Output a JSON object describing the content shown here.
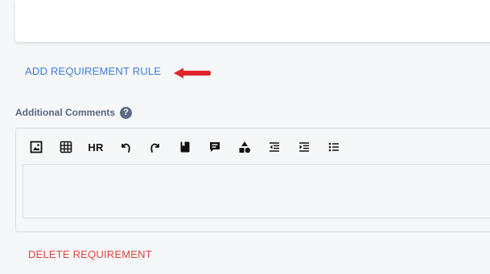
{
  "rule_section": {
    "add_rule_label": "ADD REQUIREMENT RULE",
    "link_color": "#3b7fd6",
    "annotation_arrow_color": "#e0262c"
  },
  "comments": {
    "label": "Additional Comments",
    "help_glyph": "?",
    "toolbar": {
      "buttons": [
        {
          "name": "image-icon"
        },
        {
          "name": "table-icon"
        },
        {
          "name": "hr-button",
          "label": "HR"
        },
        {
          "name": "undo-icon"
        },
        {
          "name": "redo-icon"
        },
        {
          "name": "bookmark-icon"
        },
        {
          "name": "text-block-icon"
        },
        {
          "name": "shapes-icon"
        },
        {
          "name": "outdent-icon"
        },
        {
          "name": "indent-icon"
        },
        {
          "name": "bullet-list-icon"
        }
      ]
    },
    "textarea_value": ""
  },
  "actions": {
    "delete_label": "DELETE REQUIREMENT",
    "delete_color": "#e0473f"
  }
}
